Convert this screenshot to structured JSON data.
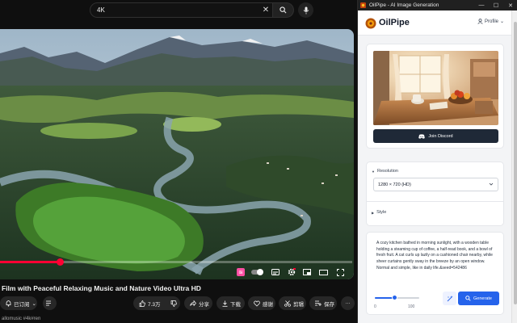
{
  "youtube": {
    "search": {
      "query": "4K",
      "clear_icon": "close-icon",
      "search_icon": "search-icon",
      "mic_icon": "mic-icon"
    },
    "video": {
      "progress": 0.17
    },
    "title": "Film with Peaceful Relaxing Music and Nature Video Ultra HD",
    "actions": {
      "subscribed": "已订阅",
      "likes": "7.3万",
      "share": "分享",
      "download": "下载",
      "thanks": "感谢",
      "clip": "剪辑",
      "save": "保存",
      "more": "···"
    },
    "footer": "allomusic #4k#ren"
  },
  "oilpipe": {
    "window_title": "OilPipe - AI Image Generation",
    "window_controls": {
      "minimize": "—",
      "maximize": "☐",
      "close": "✕"
    },
    "brand": "OilPipe",
    "profile": "Profile",
    "join_discord": "Join Discord",
    "resolution_label": "Resolution",
    "resolution_value": "1280 × 720 (HD)",
    "style_label": "Style",
    "prompt": "A cozy kitchen bathed in morning sunlight, with a wooden table holding a steaming cup of coffee, a half-read book, and a bowl of fresh fruit. A cat curls up lazily on a cushioned chair nearby, while sheer curtains gently sway in the breeze by an open window. Normal and simple, like in daily life.&seed=542486",
    "slider": {
      "min": "0",
      "max": "100",
      "value": 0.45
    },
    "generate": "Generate",
    "colors": {
      "primary": "#2563eb",
      "dark_button": "#1f2937",
      "youtube_red": "#ff0033"
    }
  }
}
